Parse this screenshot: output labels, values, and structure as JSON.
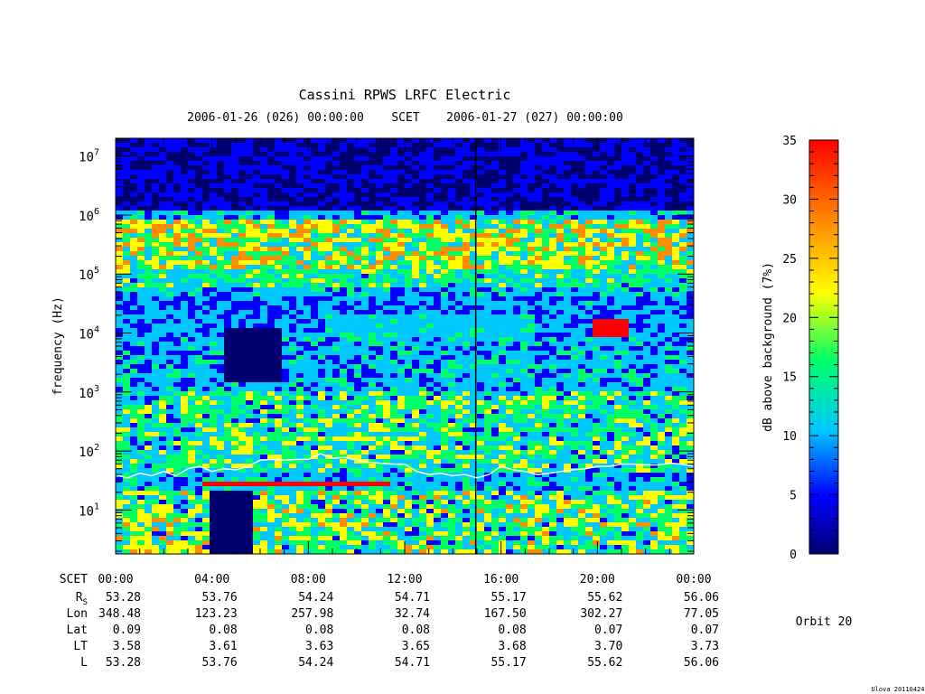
{
  "chart_data": {
    "type": "heatmap",
    "title": "Cassini RPWS LRFC Electric",
    "subtitle": {
      "start": "2006-01-26 (026) 00:00:00",
      "scet": "SCET",
      "end": "2006-01-27 (027) 00:00:00"
    },
    "ylabel": "frequency (Hz)",
    "y_scale": "log",
    "ylim": [
      1.8,
      20000000
    ],
    "y_ticks": [
      {
        "value": 10,
        "mant": "10",
        "exp": "1"
      },
      {
        "value": 100,
        "mant": "10",
        "exp": "2"
      },
      {
        "value": 1000,
        "mant": "10",
        "exp": "3"
      },
      {
        "value": 10000,
        "mant": "10",
        "exp": "4"
      },
      {
        "value": 100000,
        "mant": "10",
        "exp": "5"
      },
      {
        "value": 1000000,
        "mant": "10",
        "exp": "6"
      },
      {
        "value": 10000000,
        "mant": "10",
        "exp": "7"
      }
    ],
    "x_range_hours": [
      0,
      24
    ],
    "x_ticks": [
      "00:00",
      "04:00",
      "08:00",
      "12:00",
      "16:00",
      "20:00",
      "00:00"
    ],
    "ephemeris": {
      "labels": [
        {
          "name": "SCET",
          "text": "SCET"
        },
        {
          "name": "Rs",
          "text": "R",
          "sub": "S"
        },
        {
          "name": "Lon",
          "text": "Lon"
        },
        {
          "name": "Lat",
          "text": "Lat"
        },
        {
          "name": "LT",
          "text": "LT"
        },
        {
          "name": "L",
          "text": "L"
        }
      ],
      "rows": [
        [
          "53.28",
          "53.76",
          "54.24",
          "54.71",
          "55.17",
          "55.62",
          "56.06"
        ],
        [
          "348.48",
          "123.23",
          "257.98",
          "32.74",
          "167.50",
          "302.27",
          "77.05"
        ],
        [
          "0.09",
          "0.08",
          "0.08",
          "0.08",
          "0.08",
          "0.07",
          "0.07"
        ],
        [
          "3.58",
          "3.61",
          "3.63",
          "3.65",
          "3.68",
          "3.70",
          "3.73"
        ],
        [
          "53.28",
          "53.76",
          "54.24",
          "54.71",
          "55.17",
          "55.62",
          "56.06"
        ]
      ]
    },
    "colorbar": {
      "label": "dB above background (7%)",
      "range": [
        0,
        35
      ],
      "ticks": [
        "0",
        "5",
        "10",
        "15",
        "20",
        "25",
        "30",
        "35"
      ]
    },
    "electron_cyclotron_trace": {
      "hours": [
        0,
        0.5,
        1,
        1.5,
        2,
        2.5,
        3,
        3.5,
        4,
        4.5,
        5,
        5.5,
        6,
        6.5,
        7,
        7.5,
        8,
        8.5,
        9,
        9.5,
        10,
        10.5,
        11,
        11.5,
        12,
        12.5,
        13,
        13.5,
        14,
        14.5,
        15,
        15.5,
        16,
        16.5,
        17,
        17.5,
        18,
        18.5,
        19,
        19.5,
        20,
        20.5,
        21,
        21.5,
        22,
        22.5,
        23,
        23.5,
        24
      ],
      "freq_hz": [
        40,
        35,
        42,
        38,
        45,
        38,
        50,
        55,
        45,
        50,
        48,
        55,
        70,
        72,
        70,
        72,
        72,
        90,
        75,
        78,
        70,
        65,
        62,
        60,
        60,
        45,
        40,
        42,
        38,
        40,
        35,
        40,
        55,
        48,
        45,
        40,
        42,
        45,
        48,
        50,
        55,
        55,
        60,
        60,
        58,
        58,
        62,
        60,
        55
      ],
      "color": "#ffffff"
    },
    "colors": {
      "background": "#000066",
      "scale": [
        "#000070",
        "#0000ff",
        "#00c8ff",
        "#00ff64",
        "#ffff00",
        "#ff8c00",
        "#ff0000"
      ]
    }
  },
  "orbit": "Orbit 20",
  "footer_note": "Ulova 20110424"
}
